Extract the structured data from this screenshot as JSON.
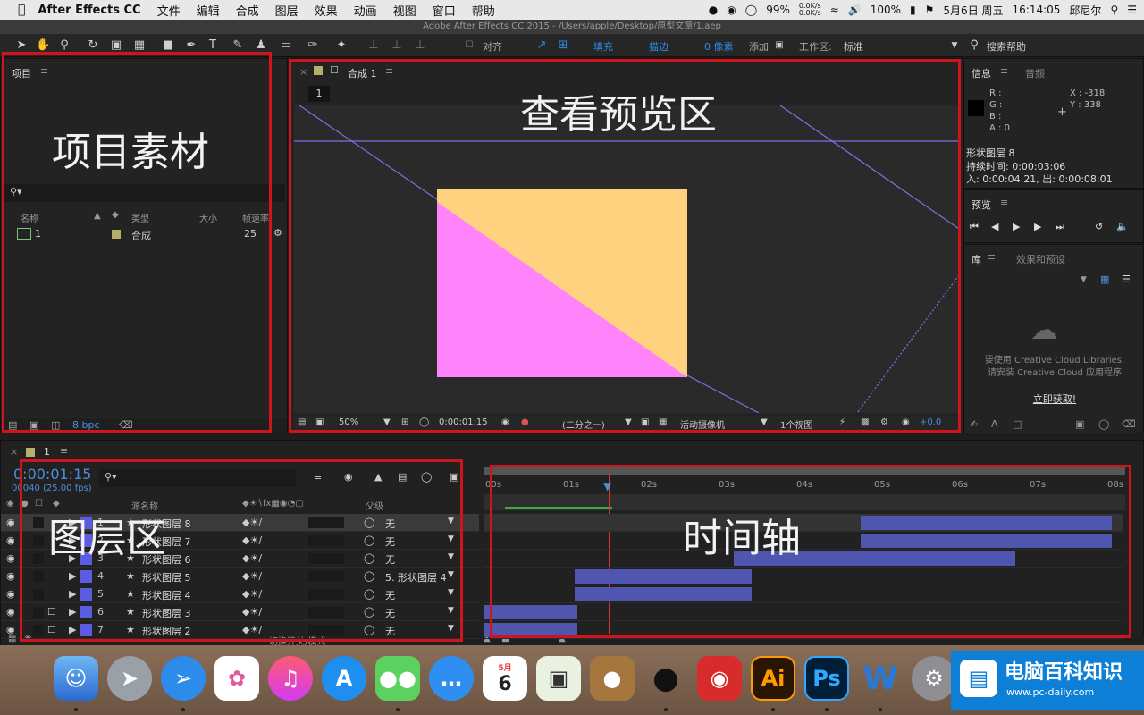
{
  "menubar": {
    "app": "After Effects CC",
    "items": [
      "文件",
      "编辑",
      "合成",
      "图层",
      "效果",
      "动画",
      "视图",
      "窗口",
      "帮助"
    ],
    "battery": "99%",
    "net_up": "0.0K/s",
    "net_down": "0.0K/s",
    "volume": "100%",
    "date": "5月6日 周五",
    "time": "16:14:05",
    "user": "邱尼尔"
  },
  "titlebar": {
    "title": "Adobe After Effects CC 2015 - /Users/apple/Desktop/原型文章/1.aep"
  },
  "toolbar": {
    "align": "对齐",
    "fill": "填充",
    "stroke": "描边",
    "stroke_px": "0 像素",
    "add": "添加",
    "workspace_label": "工作区:",
    "workspace": "标准",
    "search": "搜索帮助",
    "fill_color": "#ffd27f"
  },
  "project": {
    "title": "项目",
    "annotation": "项目素材",
    "cols": {
      "name": "名称",
      "type": "类型",
      "size": "大小",
      "fps": "帧速率"
    },
    "item": {
      "name": "1",
      "type": "合成",
      "fps": "25"
    },
    "bpc": "8 bpc"
  },
  "comp": {
    "tab": "合成 1",
    "subtab": "1",
    "annotation": "查看预览区",
    "zoom": "50%",
    "time": "0:00:01:15",
    "res": "(二分之一)",
    "camera": "活动摄像机",
    "views": "1个视图",
    "offset": "+0.0"
  },
  "info": {
    "title": "信息",
    "tab2": "音频",
    "r": "R :",
    "g": "G :",
    "b": "B :",
    "a": "A : 0",
    "x": "X : -318",
    "y": "Y : 338",
    "layer": "形状图层 8",
    "duration": "持续时间: 0:00:03:06",
    "inout": "入: 0:00:04:21, 出: 0:00:08:01"
  },
  "preview": {
    "title": "预览"
  },
  "library": {
    "title": "库",
    "tab2": "效果和预设",
    "msg1": "要使用 Creative Cloud Libraries,",
    "msg2": "请安装 Creative Cloud 应用程序",
    "cta": "立即获取!"
  },
  "timeline": {
    "tab": "1",
    "time": "0:00:01:15",
    "frames": "00040 (25.00 fps)",
    "annotation_layers": "图层区",
    "annotation_axis": "时间轴",
    "col_name": "源名称",
    "col_parent": "父级",
    "footer": "切换开关/模式",
    "ruler": [
      "00s",
      "01s",
      "02s",
      "03s",
      "04s",
      "05s",
      "06s",
      "07s",
      "08s"
    ],
    "layers": [
      {
        "num": "1",
        "name": "形状图层 8",
        "parent": "无"
      },
      {
        "num": "2",
        "name": "形状图层 7",
        "parent": "无"
      },
      {
        "num": "3",
        "name": "形状图层 6",
        "parent": "无"
      },
      {
        "num": "4",
        "name": "形状图层 5",
        "parent": "5. 形状图层 4"
      },
      {
        "num": "5",
        "name": "形状图层 4",
        "parent": "无"
      },
      {
        "num": "6",
        "name": "形状图层 3",
        "parent": "无"
      },
      {
        "num": "7",
        "name": "形状图层 2",
        "parent": "无"
      }
    ]
  },
  "dock": {
    "calendar_month": "5月",
    "calendar_day": "6",
    "ai": "Ai",
    "ps": "Ps",
    "watermark_title": "电脑百科知识",
    "watermark_url": "www.pc-daily.com"
  }
}
